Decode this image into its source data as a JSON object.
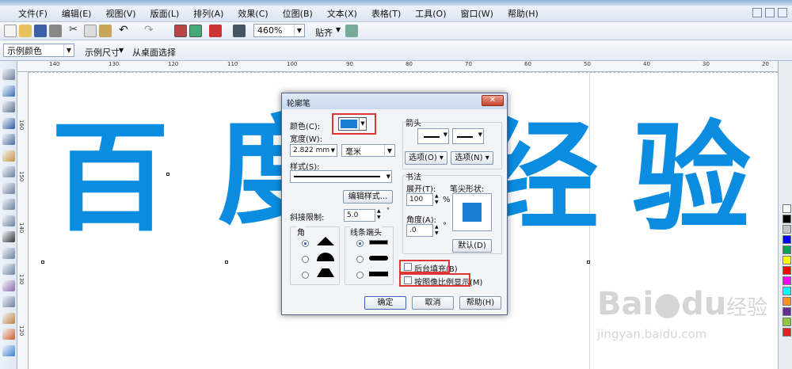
{
  "menu": [
    "文件(F)",
    "编辑(E)",
    "视图(V)",
    "版面(L)",
    "排列(A)",
    "效果(C)",
    "位图(B)",
    "文本(X)",
    "表格(T)",
    "工具(O)",
    "窗口(W)",
    "帮助(H)"
  ],
  "toolbar": {
    "zoom": "460%",
    "snap_label": "贴齐"
  },
  "propbar": {
    "sample_color": "示例颜色",
    "sample_size": "示例尺寸",
    "from_desktop": "从桌面选择"
  },
  "ruler": {
    "h_ticks": [
      "140",
      "130",
      "120",
      "110",
      "100",
      "90",
      "80",
      "70",
      "60",
      "50",
      "40",
      "30",
      "20"
    ],
    "v_ticks": [
      "160",
      "150",
      "140",
      "130",
      "120"
    ]
  },
  "canvas": {
    "chars": [
      "百",
      "度",
      "经",
      "验"
    ],
    "text_color": "#0a8ce0"
  },
  "left_tools": [
    "pick-tool",
    "shape-tool",
    "crop-tool",
    "zoom-tool",
    "freehand-tool",
    "smart-fill-tool",
    "rectangle-tool",
    "ellipse-tool",
    "polygon-tool",
    "basic-shapes-tool",
    "text-tool",
    "table-tool",
    "parallel-dimension-tool",
    "interactive-blend-tool",
    "eyedropper-tool",
    "outline-tool",
    "fill-tool",
    "interactive-fill-tool"
  ],
  "palette": [
    "#ffffff",
    "#000000",
    "#c0c0c0",
    "#0000ff",
    "#00a651",
    "#ffff00",
    "#ff0000",
    "#ff00ff",
    "#00ffff",
    "#f7941d",
    "#662d91",
    "#8dc63f",
    "#ed1c24"
  ],
  "dialog": {
    "title": "轮廓笔",
    "color_label": "颜色(C):",
    "width_label": "宽度(W):",
    "width_value": "2.822 mm",
    "unit_value": "毫米",
    "style_label": "样式(S):",
    "edit_style_button": "编辑样式...",
    "miter_label": "斜接限制:",
    "miter_value": "5.0",
    "corner_label": "角",
    "cap_label": "线条端头",
    "arrow_label": "箭头",
    "options_left": "选项(O)",
    "options_right": "选项(N)",
    "calligraphy_label": "书法",
    "stretch_label": "展开(T):",
    "stretch_value": "100",
    "stretch_unit": "%",
    "angle_label": "角度(A):",
    "angle_value": ".0",
    "angle_unit": "°",
    "nib_label": "笔尖形状:",
    "default_button": "默认(D)",
    "behind_fill": "后台填充(B)",
    "scale_with_image": "按图像比例显示(M)",
    "ok": "确定",
    "cancel": "取消",
    "help": "帮助(H)",
    "color_value": "#1a7fd4"
  },
  "watermark": {
    "brand": "Bai",
    "brand2": "du",
    "jingyan": "经验",
    "url": "jingyan.baidu.com"
  }
}
